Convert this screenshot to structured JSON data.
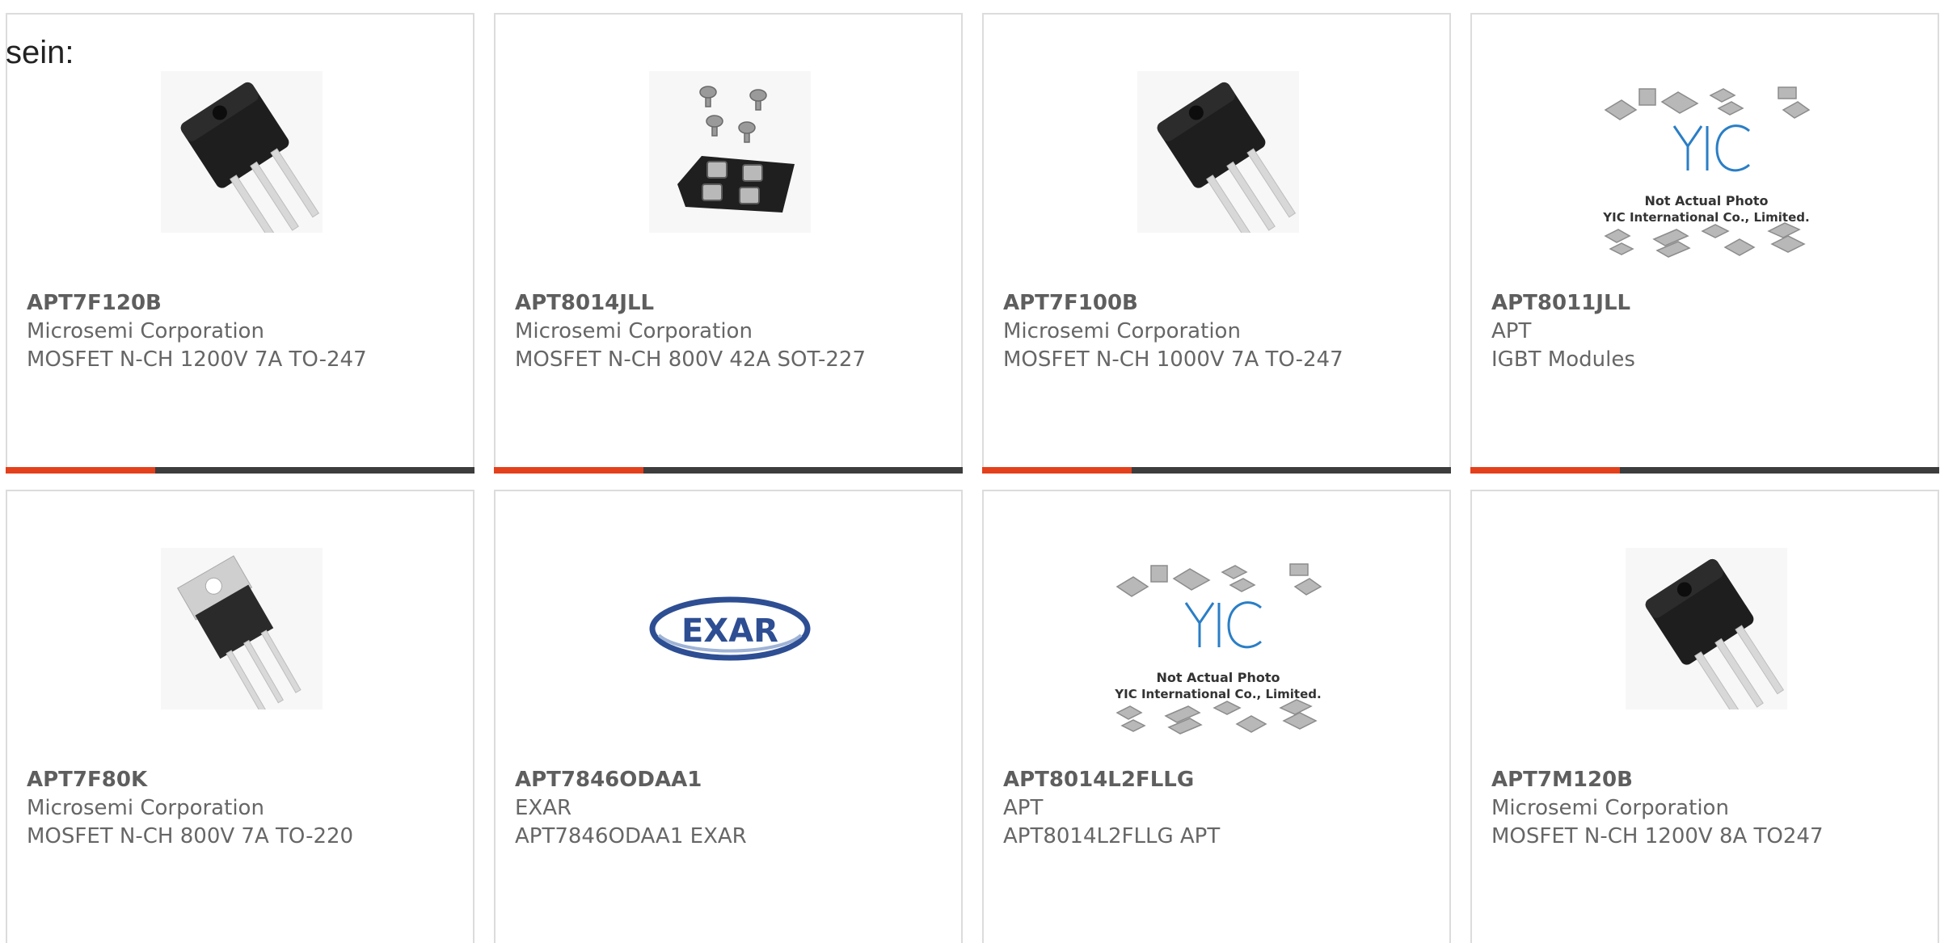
{
  "page_fragment_text": "sein:",
  "colors": {
    "accent": "#e4401c",
    "bar_dark": "#3d3d3d",
    "card_border": "#dcdcdc",
    "text_grey": "#666666"
  },
  "products": [
    {
      "part_number": "APT7F120B",
      "manufacturer": "Microsemi Corporation",
      "description": "MOSFET N-CH 1200V 7A TO-247",
      "image_icon": "to247-transistor-icon"
    },
    {
      "part_number": "APT8014JLL",
      "manufacturer": "Microsemi Corporation",
      "description": "MOSFET N-CH 800V 42A SOT-227",
      "image_icon": "sot227-module-icon"
    },
    {
      "part_number": "APT7F100B",
      "manufacturer": "Microsemi Corporation",
      "description": "MOSFET N-CH 1000V 7A TO-247",
      "image_icon": "to247-transistor-icon"
    },
    {
      "part_number": "APT8011JLL",
      "manufacturer": "APT",
      "description": "IGBT Modules",
      "image_icon": "yic-placeholder-icon",
      "placeholder_line1": "Not Actual Photo",
      "placeholder_line2": "YIC International Co., Limited."
    },
    {
      "part_number": "APT7F80K",
      "manufacturer": "Microsemi Corporation",
      "description": "MOSFET N-CH 800V 7A TO-220",
      "image_icon": "to220-transistor-icon"
    },
    {
      "part_number": "APT7846ODAA1",
      "manufacturer": "EXAR",
      "description": "APT7846ODAA1 EXAR",
      "image_icon": "exar-logo-icon",
      "logo_text": "EXAR"
    },
    {
      "part_number": "APT8014L2FLLG",
      "manufacturer": "APT",
      "description": "APT8014L2FLLG APT",
      "image_icon": "yic-placeholder-icon",
      "placeholder_line1": "Not Actual Photo",
      "placeholder_line2": "YIC International Co., Limited."
    },
    {
      "part_number": "APT7M120B",
      "manufacturer": "Microsemi Corporation",
      "description": "MOSFET N-CH 1200V 8A TO247",
      "image_icon": "to247-transistor-icon"
    }
  ]
}
